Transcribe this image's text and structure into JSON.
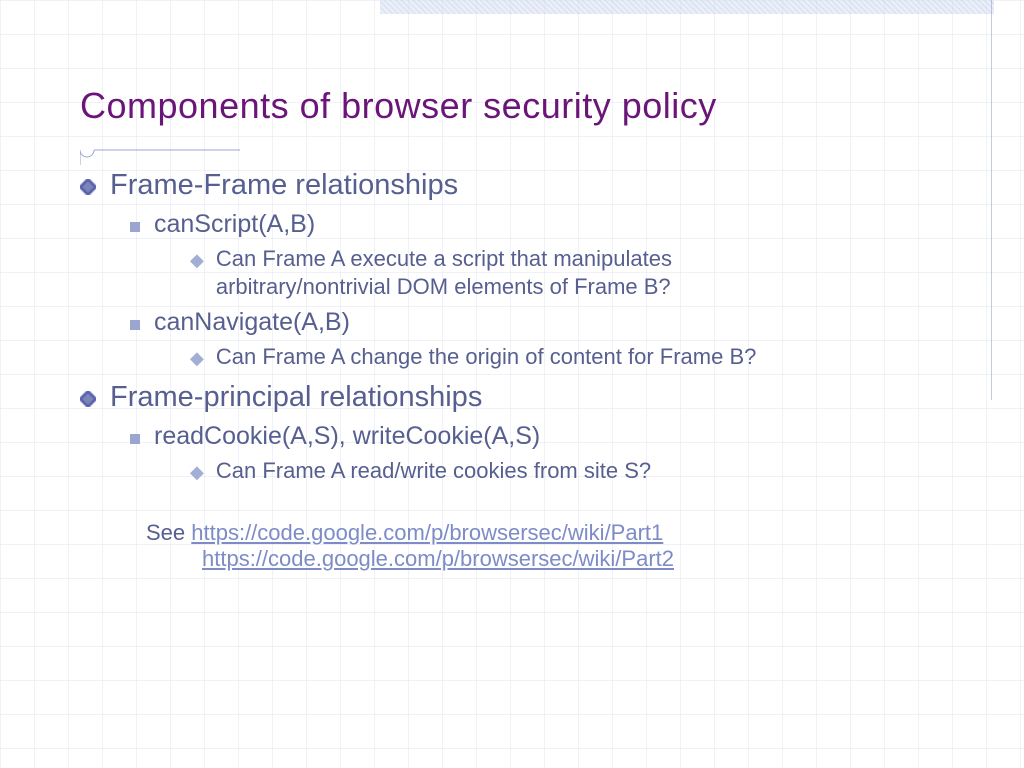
{
  "title": "Components of browser security policy",
  "content": {
    "section1": {
      "heading": "Frame-Frame relationships",
      "items": [
        {
          "label": "canScript(A,B)",
          "detail": "Can Frame A execute a script that manipulates arbitrary/nontrivial DOM elements of Frame B?"
        },
        {
          "label": "canNavigate(A,B)",
          "detail": "Can Frame A change the origin of content for Frame B?"
        }
      ]
    },
    "section2": {
      "heading": "Frame-principal relationships",
      "items": [
        {
          "label": "readCookie(A,S), writeCookie(A,S)",
          "detail": "Can Frame A read/write cookies from site S?"
        }
      ]
    }
  },
  "footer": {
    "prefix": "See ",
    "link1": "https://code.google.com/p/browsersec/wiki/Part1",
    "link2": "https://code.google.com/p/browsersec/wiki/Part2"
  }
}
